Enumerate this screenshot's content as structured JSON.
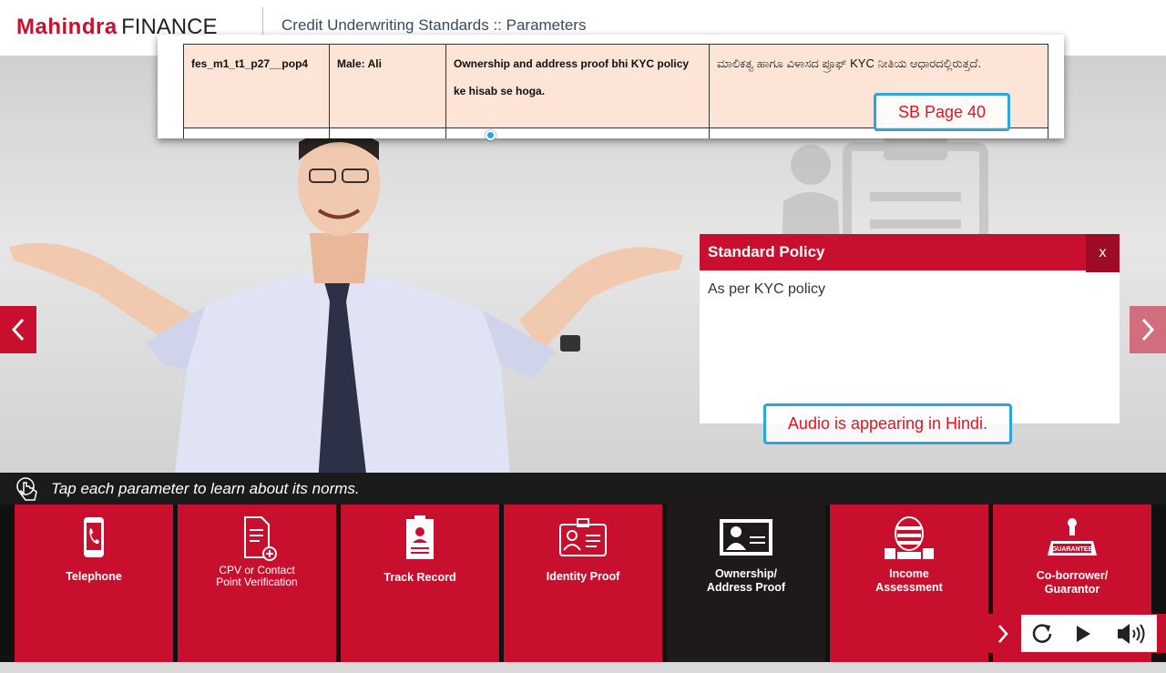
{
  "header": {
    "logo_brand": "Mahindra",
    "logo_word": "FINANCE",
    "title": "Credit Underwriting Standards :: Parameters"
  },
  "overlay_table": {
    "row": {
      "id": "fes_m1_t1_p27__pop4",
      "speaker": "Male: Ali",
      "english": "Ownership and address proof bhi KYC policy ke hisab se hoga.",
      "kannada": "ಮಾಲಿಕತ್ವ ಹಾಗೂ ವಿಳಾಸದ ಪ್ರೂಫ್ KYC ನೀತಿಯ ಆಧಾರದಲ್ಲಿರುತ್ತದೆ."
    }
  },
  "annotations": {
    "sb_page": "SB Page 40",
    "audio_note": "Audio is appearing in Hindi."
  },
  "popup": {
    "title": "Standard Policy",
    "close_label": "x",
    "body": "As per KYC policy"
  },
  "instruction": "Tap each parameter to learn about its norms.",
  "tiles": [
    {
      "label": "Telephone",
      "icon": "telephone-icon",
      "active": false
    },
    {
      "label": "CPV or Contact\nPoint Verification",
      "icon": "document-add-icon",
      "active": false
    },
    {
      "label": "Track Record",
      "icon": "record-book-icon",
      "active": false
    },
    {
      "label": "Identity Proof",
      "icon": "id-card-icon",
      "active": false
    },
    {
      "label": "Ownership/\nAddress Proof",
      "icon": "address-card-icon",
      "active": true
    },
    {
      "label": "Income\nAssessment",
      "icon": "money-stack-icon",
      "active": false
    },
    {
      "label": "Co-borrower/\nGuarantor",
      "icon": "guarantee-stamp-icon",
      "active": false
    }
  ],
  "colors": {
    "brand_red": "#c8102e",
    "dark_red": "#9e0b26",
    "active_tile": "#1e1a1a",
    "callout_border": "#2aa6de",
    "callout_text": "#e0141f"
  }
}
